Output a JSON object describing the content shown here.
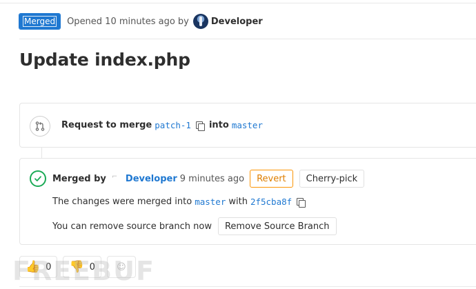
{
  "header": {
    "status": "Merged",
    "opened_text": "Opened 10 minutes ago by",
    "author": "Developer"
  },
  "title": "Update index.php",
  "request": {
    "prefix": "Request to merge",
    "source_branch": "patch-1",
    "into": "into",
    "target_branch": "master"
  },
  "merged": {
    "merged_by": "Merged by",
    "author": "Developer",
    "time": "9 minutes ago",
    "revert_label": "Revert",
    "cherry_pick_label": "Cherry-pick",
    "changes_text": "The changes were merged into",
    "target_branch": "master",
    "with": "with",
    "commit": "2f5cba8f",
    "remove_text": "You can remove source branch now",
    "remove_button_label": "Remove Source Branch"
  },
  "awards": {
    "thumbs_up_count": "0",
    "thumbs_down_count": "0"
  },
  "watermark": "FREEBUF",
  "icons": {
    "merge": "merge-request-icon",
    "copy": "copy-icon",
    "check": "check-circle-icon",
    "thumbs_up": "thumbs-up-icon",
    "thumbs_down": "thumbs-down-icon",
    "smile": "smiley-icon"
  },
  "colors": {
    "badge": "#1f78d1",
    "link": "#1f78d1",
    "success": "#1aaa55",
    "revert": "#fc9403"
  }
}
